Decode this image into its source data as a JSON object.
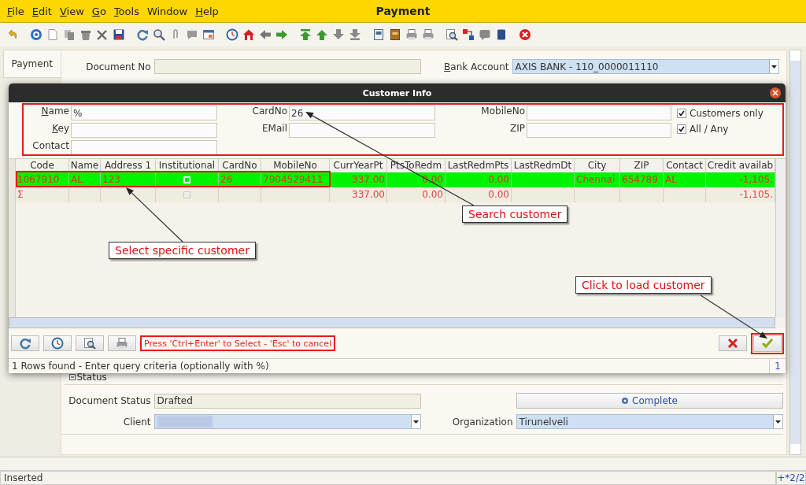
{
  "window": {
    "title": "Payment"
  },
  "menu": [
    {
      "label": "File",
      "underline_first": true
    },
    {
      "label": "Edit",
      "underline_first": true
    },
    {
      "label": "View",
      "underline_first": true
    },
    {
      "label": "Go",
      "underline_first": true
    },
    {
      "label": "Tools",
      "underline_first": true
    },
    {
      "label": "Window",
      "underline_first": false
    },
    {
      "label": "Help",
      "underline_first": true
    }
  ],
  "tabs": [
    {
      "label": "Payment",
      "selected": true
    }
  ],
  "form": {
    "document_no": {
      "label": "Document No",
      "underline_first": false
    },
    "bank_account": {
      "label": "Bank Account",
      "underline_first": true,
      "value": "AXIS BANK - 110_0000011110"
    },
    "section": {
      "title": "Status",
      "expanded": true
    },
    "document_status": {
      "label": "Document Status",
      "value": "Drafted"
    },
    "complete_button": "Complete",
    "client": {
      "label": "Client"
    },
    "organization": {
      "label": "Organization",
      "value": "Tirunelveli"
    }
  },
  "dialog": {
    "title": "Customer Info",
    "filter_columns": [
      [
        {
          "label": "Name",
          "underline_first": true,
          "value": "%"
        },
        {
          "label": "Key",
          "underline_first": true
        },
        {
          "label": "Contact",
          "underline_first": false
        }
      ],
      [
        {
          "label": "CardNo",
          "underline_first": false,
          "value": "26"
        },
        {
          "label": "EMail",
          "underline_first": false
        }
      ],
      [
        {
          "label": "MobileNo",
          "underline_first": false
        },
        {
          "label": "ZIP",
          "underline_first": false
        }
      ]
    ],
    "options": [
      {
        "label": "Customers only",
        "checked": true
      },
      {
        "label": "All / Any",
        "checked": true
      }
    ],
    "table": {
      "columns": [
        {
          "label": "Code",
          "kind": "text"
        },
        {
          "label": "Name",
          "kind": "text"
        },
        {
          "label": "Address 1",
          "kind": "text"
        },
        {
          "label": "Institutional",
          "kind": "check"
        },
        {
          "label": "CardNo",
          "kind": "text"
        },
        {
          "label": "MobileNo",
          "kind": "text"
        },
        {
          "label": "CurrYearPt",
          "kind": "number"
        },
        {
          "label": "PtsToRedm",
          "kind": "number"
        },
        {
          "label": "LastRedmPts",
          "kind": "number"
        },
        {
          "label": "LastRedmDt",
          "kind": "text"
        },
        {
          "label": "City",
          "kind": "text"
        },
        {
          "label": "ZIP",
          "kind": "text"
        },
        {
          "label": "Contact",
          "kind": "text"
        },
        {
          "label": "Credit availab",
          "kind": "number"
        }
      ],
      "rows": [
        {
          "kind": "record",
          "selected": true,
          "cells": [
            "1067910",
            "AL",
            "123",
            false,
            "26",
            "7904529411",
            "337.00",
            "0.00",
            "0.00",
            null,
            "Chennai",
            "654789",
            "AL",
            "-1,105."
          ]
        },
        {
          "kind": "total",
          "selected": false,
          "cells": [
            "Σ",
            null,
            null,
            false,
            null,
            null,
            "337.00",
            "0.00",
            "0.00",
            null,
            null,
            null,
            null,
            "-1,105."
          ]
        }
      ]
    },
    "hint": "Press 'Ctrl+Enter' to Select - 'Esc' to cancel",
    "status": "1 Rows found - Enter query criteria (optionally with %)",
    "count": "1"
  },
  "annotations": [
    {
      "text": "Search customer"
    },
    {
      "text": "Select specific customer"
    },
    {
      "text": "Click to load customer"
    }
  ],
  "status_bar": {
    "message": "Inserted",
    "record": "+*2/2"
  }
}
